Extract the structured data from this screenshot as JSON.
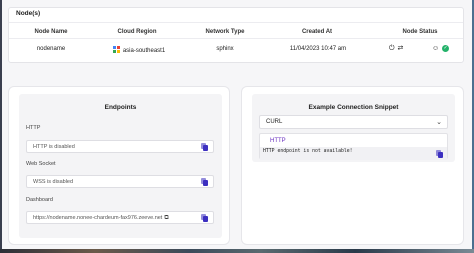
{
  "nodes": {
    "header": "Node(s)",
    "columns": [
      "Node Name",
      "Cloud Region",
      "Network Type",
      "Created At",
      "Node Status"
    ],
    "rows": [
      {
        "name": "nodename",
        "region": "asia-southeast1",
        "network": "sphinx",
        "created": "11/04/2023 10:47 am",
        "status": "active"
      }
    ]
  },
  "endpoints": {
    "title": "Endpoints",
    "http": {
      "label": "HTTP",
      "value": "HTTP is disabled"
    },
    "ws": {
      "label": "Web Socket",
      "value": "WSS is disabled"
    },
    "dashboard": {
      "label": "Dashboard",
      "value": "https://nodename.nonee-chardeum-fax976.zeeve.net"
    }
  },
  "snippet": {
    "title": "Example Connection Snippet",
    "selected": "CURL",
    "tab": "HTTP",
    "code": "HTTP endpoint is not available!"
  },
  "colors": {
    "accent": "#3c2fc0",
    "tab": "#6a2fc0",
    "ok": "#23b26a"
  },
  "icons": [
    "gcp-region-icon",
    "power-icon",
    "refresh-icon",
    "user-circle-icon",
    "status-ok-icon",
    "copy-icon",
    "external-link-icon",
    "chevron-down-icon"
  ]
}
